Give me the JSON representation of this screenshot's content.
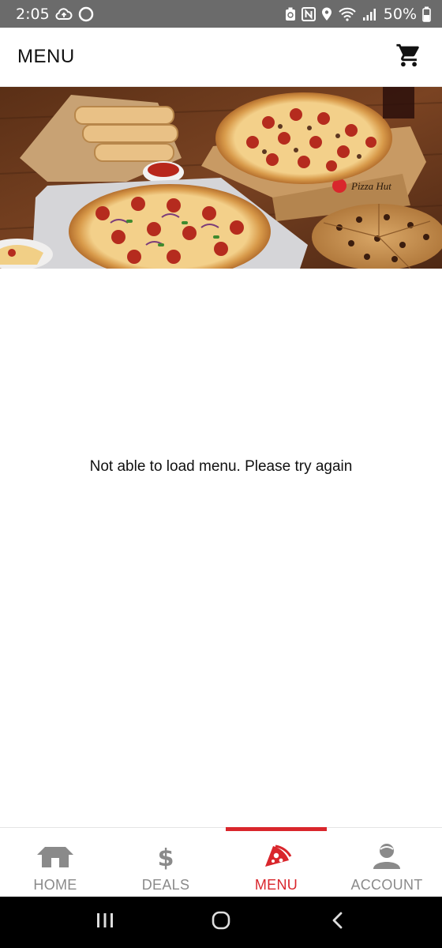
{
  "status_bar": {
    "time": "2:05",
    "battery": "50%"
  },
  "header": {
    "title": "MENU",
    "cart_icon": "cart-icon"
  },
  "hero": {
    "image": "pizza-spread-photo",
    "box_brand": "Pizza Hut"
  },
  "main": {
    "message": "Not able to load menu. Please try again"
  },
  "bottom_nav": {
    "items": [
      {
        "label": "HOME",
        "icon": "home-icon",
        "active": false
      },
      {
        "label": "DEALS",
        "icon": "dollar-icon",
        "active": false
      },
      {
        "label": "MENU",
        "icon": "pizza-slice-icon",
        "active": true
      },
      {
        "label": "ACCOUNT",
        "icon": "account-icon",
        "active": false
      }
    ]
  },
  "colors": {
    "accent": "#d9262c",
    "inactive": "#8a8a8a",
    "status_bar": "#6b6b6b"
  }
}
